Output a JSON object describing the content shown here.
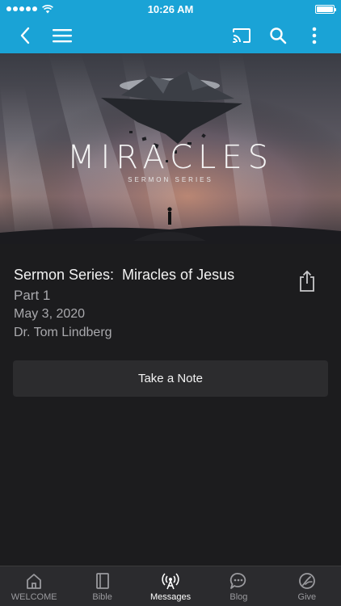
{
  "status_bar": {
    "time": "10:26 AM"
  },
  "hero": {
    "title": "MIRACLES",
    "subtitle": "SERMON SERIES"
  },
  "sermon": {
    "title": "Sermon Series:  Miracles of Jesus",
    "part": "Part 1",
    "date": "May 3, 2020",
    "speaker": "Dr. Tom Lindberg"
  },
  "actions": {
    "take_note_label": "Take a Note"
  },
  "tabs": [
    {
      "label": "WELCOME",
      "icon": "home-icon"
    },
    {
      "label": "Bible",
      "icon": "book-icon"
    },
    {
      "label": "Messages",
      "icon": "broadcast-icon",
      "active": true
    },
    {
      "label": "Blog",
      "icon": "chat-bubble-icon"
    },
    {
      "label": "Give",
      "icon": "give-icon"
    }
  ],
  "colors": {
    "accent": "#1aa3d6",
    "background": "#1c1c1e",
    "tab_bar": "#2b2b2e"
  }
}
